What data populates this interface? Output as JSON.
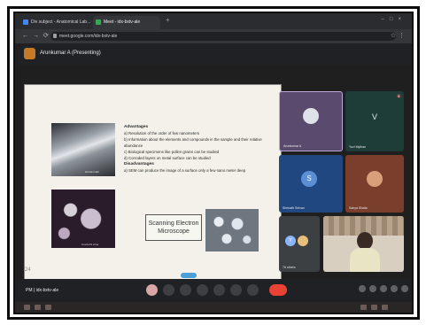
{
  "browser": {
    "tabs": [
      {
        "label": "Div subject - Anatomical Lab..."
      },
      {
        "label": "Meet - idx-bxtv-ale"
      }
    ],
    "url": "meet.google.com/idx-bxtv-ale"
  },
  "meeting": {
    "presenter_label": "Arunkumar A (Presenting)",
    "meeting_code": "idx-bxtv-ale",
    "time": "PM"
  },
  "slide": {
    "advantages_heading": "Advantages",
    "advantages": [
      "a) Resolution of the order of few nanometers",
      "b) Information about the elements and compounds in the sample and their relative abundance",
      "c) Biological specimens like pollen grains can be studied",
      "d) Corroded layers on metal surface can be studied"
    ],
    "disadvantages_heading": "Disadvantages",
    "disadvantages": [
      "a) SEM can produce the image of a surface only a few nano meter deep"
    ],
    "sem_label_line1": "Scanning Electron",
    "sem_label_line2": "Microscope",
    "hair_caption": "Human Hair",
    "virus_caption": "Covid-19 virus",
    "watermark": "24"
  },
  "participants": [
    {
      "name": "Arunkumar A",
      "initial": ""
    },
    {
      "name": "Yuvi Mythan",
      "initial": "V"
    },
    {
      "name": "Shrinath Selvan",
      "initial": "S"
    },
    {
      "name": "Sahya Shaila",
      "initial": ""
    },
    {
      "name": "76 others",
      "initial": "Y"
    },
    {
      "name": "",
      "initial": ""
    }
  ],
  "colors": {
    "end_call": "#ea4335",
    "accent": "#4ca0d8"
  }
}
